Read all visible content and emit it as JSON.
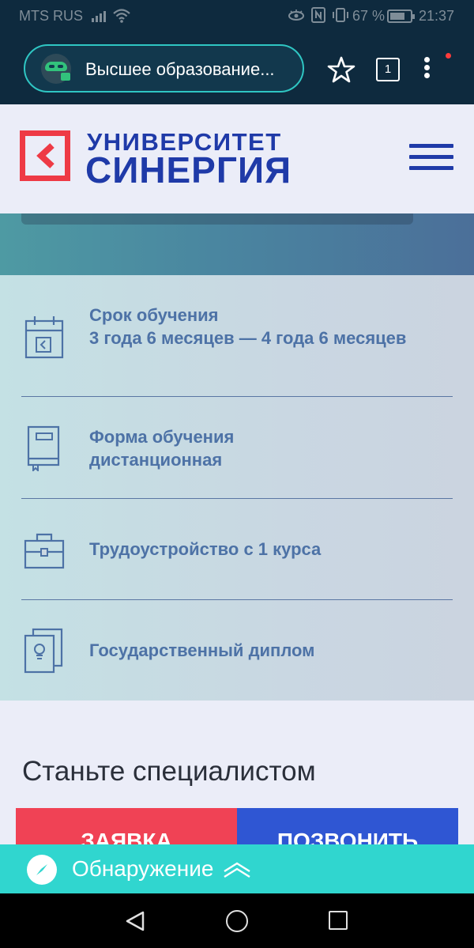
{
  "status_bar": {
    "carrier": "MTS RUS",
    "battery_percent": "67 %",
    "time": "21:37"
  },
  "browser": {
    "url_text": "Высшее образование...",
    "tab_count": "1",
    "icons": [
      "incognito-icon",
      "star-icon",
      "tabs-icon",
      "more-vert-icon"
    ]
  },
  "site_header": {
    "logo_line1": "УНИВЕРСИТЕТ",
    "logo_line2": "СИНЕРГИЯ",
    "brand_colors": {
      "red": "#ee3a45",
      "blue": "#1f3aa8"
    }
  },
  "features": [
    {
      "icon": "calendar-icon",
      "label": "Срок обучения",
      "detail": "3 года 6 месяцев — 4 года 6 месяцев"
    },
    {
      "icon": "book-icon",
      "label": "Форма обучения",
      "detail": "дистанционная"
    },
    {
      "icon": "briefcase-icon",
      "label": "Трудоустройство с 1 курса"
    },
    {
      "icon": "diploma-icon",
      "label": "Государственный диплом"
    }
  ],
  "main": {
    "headline": "Станьте специалистом",
    "cta_left": "ЗАЯВКА",
    "cta_right": "ПОЗВОНИТЬ"
  },
  "discover_bar": {
    "label": "Обнаружение",
    "color": "#30d6cf"
  },
  "nav_bar": {
    "icons": [
      "back-icon",
      "home-icon",
      "recent-apps-icon"
    ]
  }
}
